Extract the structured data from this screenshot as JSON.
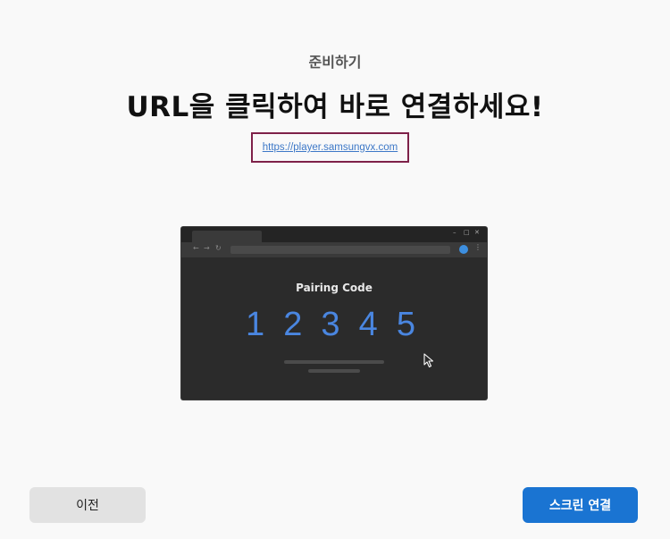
{
  "header": {
    "subtitle": "준비하기",
    "title": "URL을 클릭하여 바로 연결하세요!"
  },
  "link": {
    "url_text": "https://player.samsungvx.com"
  },
  "illustration": {
    "window_controls": {
      "minimize": "–",
      "maximize": "□",
      "close": "✕"
    },
    "nav": {
      "back": "←",
      "forward": "→",
      "reload": "↻"
    },
    "menu_glyph": "⋮",
    "pairing_label": "Pairing Code",
    "digits": [
      "1",
      "2",
      "3",
      "4",
      "5"
    ],
    "colors": {
      "digits": "#4a86e0",
      "profile": "#3d8fe0",
      "window_bg": "#2b2b2b"
    }
  },
  "footer": {
    "prev_label": "이전",
    "connect_label": "스크린 연결"
  },
  "colors": {
    "accent": "#1a74d2",
    "link_highlight": "#7e2149"
  }
}
